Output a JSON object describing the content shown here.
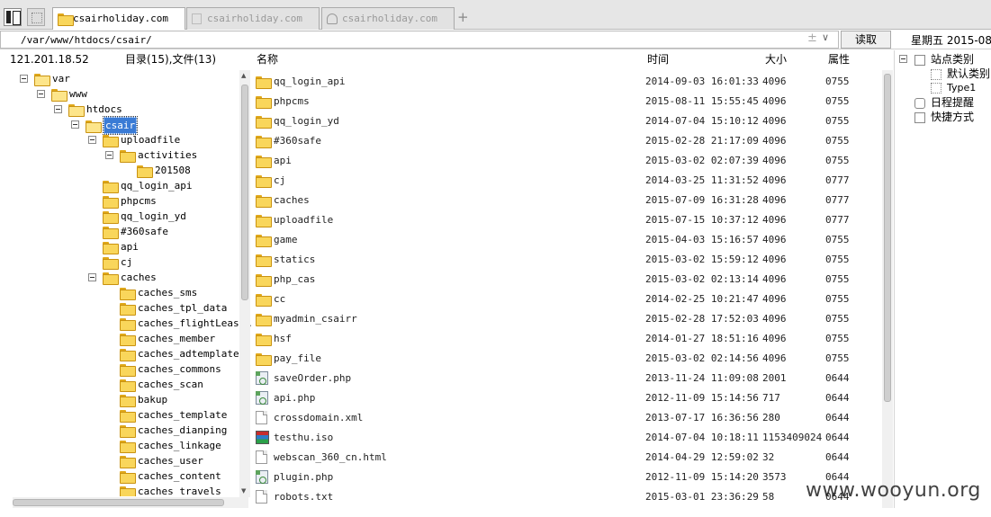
{
  "tabs": [
    {
      "label": "csairholiday.com",
      "active": true
    },
    {
      "label": "csairholiday.com",
      "active": false
    },
    {
      "label": "csairholiday.com",
      "active": false
    }
  ],
  "new_tab_label": "+",
  "address": {
    "path": "/var/www/htdocs/csair/",
    "plus": "±",
    "dropdown": "∨",
    "read_label": "读取"
  },
  "clock": "星期五 2015-08-",
  "info": {
    "ip": "121.201.18.52",
    "summary": "目录(15),文件(13)"
  },
  "columns": {
    "name": "名称",
    "time": "时间",
    "size": "大小",
    "attr": "属性"
  },
  "tree": [
    {
      "label": "var",
      "toggle": true,
      "open": true
    },
    {
      "label": "www",
      "toggle": true,
      "open": true
    },
    {
      "label": "htdocs",
      "toggle": true,
      "open": true
    },
    {
      "label": "csair",
      "toggle": true,
      "open": true,
      "selected": true
    },
    {
      "label": "uploadfile",
      "toggle": true,
      "open": false
    },
    {
      "label": "activities",
      "toggle": true,
      "open": false
    },
    {
      "label": "201508",
      "toggle": false,
      "open": false
    },
    {
      "label": "qq_login_api",
      "toggle": false,
      "open": false
    },
    {
      "label": "phpcms",
      "toggle": false,
      "open": false
    },
    {
      "label": "qq_login_yd",
      "toggle": false,
      "open": false
    },
    {
      "label": "#360safe",
      "toggle": false,
      "open": false
    },
    {
      "label": "api",
      "toggle": false,
      "open": false
    },
    {
      "label": "cj",
      "toggle": false,
      "open": false
    },
    {
      "label": "caches",
      "toggle": true,
      "open": false
    },
    {
      "label": "caches_sms",
      "toggle": false,
      "open": false
    },
    {
      "label": "caches_tpl_data",
      "toggle": false,
      "open": false
    },
    {
      "label": "caches_flightLeastA",
      "toggle": false,
      "open": false
    },
    {
      "label": "caches_member",
      "toggle": false,
      "open": false
    },
    {
      "label": "caches_adtemplate",
      "toggle": false,
      "open": false
    },
    {
      "label": "caches_commons",
      "toggle": false,
      "open": false
    },
    {
      "label": "caches_scan",
      "toggle": false,
      "open": false
    },
    {
      "label": "bakup",
      "toggle": false,
      "open": false
    },
    {
      "label": "caches_template",
      "toggle": false,
      "open": false
    },
    {
      "label": "caches_dianping",
      "toggle": false,
      "open": false
    },
    {
      "label": "caches_linkage",
      "toggle": false,
      "open": false
    },
    {
      "label": "caches_user",
      "toggle": false,
      "open": false
    },
    {
      "label": "caches_content",
      "toggle": false,
      "open": false
    },
    {
      "label": "caches_travels",
      "toggle": false,
      "open": false
    }
  ],
  "files": [
    {
      "name": "qq_login_api",
      "time": "2014-09-03 16:01:33",
      "size": "4096",
      "attr": "0755",
      "type": "folder"
    },
    {
      "name": "phpcms",
      "time": "2015-08-11 15:55:45",
      "size": "4096",
      "attr": "0755",
      "type": "folder"
    },
    {
      "name": "qq_login_yd",
      "time": "2014-07-04 15:10:12",
      "size": "4096",
      "attr": "0755",
      "type": "folder"
    },
    {
      "name": "#360safe",
      "time": "2015-02-28 21:17:09",
      "size": "4096",
      "attr": "0755",
      "type": "folder"
    },
    {
      "name": "api",
      "time": "2015-03-02 02:07:39",
      "size": "4096",
      "attr": "0755",
      "type": "folder"
    },
    {
      "name": "cj",
      "time": "2014-03-25 11:31:52",
      "size": "4096",
      "attr": "0777",
      "type": "folder"
    },
    {
      "name": "caches",
      "time": "2015-07-09 16:31:28",
      "size": "4096",
      "attr": "0777",
      "type": "folder"
    },
    {
      "name": "uploadfile",
      "time": "2015-07-15 10:37:12",
      "size": "4096",
      "attr": "0777",
      "type": "folder"
    },
    {
      "name": "game",
      "time": "2015-04-03 15:16:57",
      "size": "4096",
      "attr": "0755",
      "type": "folder"
    },
    {
      "name": "statics",
      "time": "2015-03-02 15:59:12",
      "size": "4096",
      "attr": "0755",
      "type": "folder"
    },
    {
      "name": "php_cas",
      "time": "2015-03-02 02:13:14",
      "size": "4096",
      "attr": "0755",
      "type": "folder"
    },
    {
      "name": "cc",
      "time": "2014-02-25 10:21:47",
      "size": "4096",
      "attr": "0755",
      "type": "folder"
    },
    {
      "name": "myadmin_csairr",
      "time": "2015-02-28 17:52:03",
      "size": "4096",
      "attr": "0755",
      "type": "folder"
    },
    {
      "name": "hsf",
      "time": "2014-01-27 18:51:16",
      "size": "4096",
      "attr": "0755",
      "type": "folder"
    },
    {
      "name": "pay_file",
      "time": "2015-03-02 02:14:56",
      "size": "4096",
      "attr": "0755",
      "type": "folder"
    },
    {
      "name": "saveOrder.php",
      "time": "2013-11-24 11:09:08",
      "size": "2001",
      "attr": "0644",
      "type": "php"
    },
    {
      "name": "api.php",
      "time": "2012-11-09 15:14:56",
      "size": "717",
      "attr": "0644",
      "type": "php"
    },
    {
      "name": "crossdomain.xml",
      "time": "2013-07-17 16:36:56",
      "size": "280",
      "attr": "0644",
      "type": "file"
    },
    {
      "name": "testhu.iso",
      "time": "2014-07-04 10:18:11",
      "size": "1153409024",
      "attr": "0644",
      "type": "iso"
    },
    {
      "name": "webscan_360_cn.html",
      "time": "2014-04-29 12:59:02",
      "size": "32",
      "attr": "0644",
      "type": "file"
    },
    {
      "name": "plugin.php",
      "time": "2012-11-09 15:14:20",
      "size": "3573",
      "attr": "0644",
      "type": "php"
    },
    {
      "name": "robots.txt",
      "time": "2015-03-01 23:36:29",
      "size": "58",
      "attr": "0644",
      "type": "file"
    }
  ],
  "right_panel": {
    "site_category": "站点类别",
    "default_category": "默认类别",
    "type1": "Type1",
    "schedule": "日程提醒",
    "shortcuts": "快捷方式"
  },
  "watermark": "www.wooyun.org"
}
